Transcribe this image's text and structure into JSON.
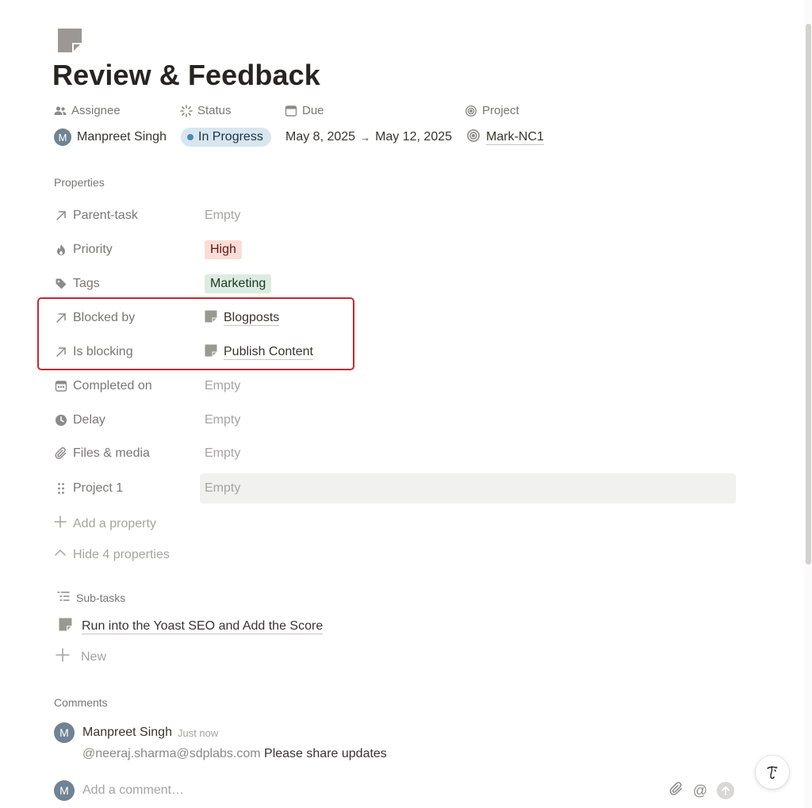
{
  "page": {
    "icon": "page-doc-icon",
    "title": "Review & Feedback"
  },
  "top_properties": {
    "assignee": {
      "label": "Assignee",
      "avatar_initial": "M",
      "value": "Manpreet Singh"
    },
    "status": {
      "label": "Status",
      "value": "In Progress",
      "color": "#d8e6f0",
      "dot_color": "#4a88b7"
    },
    "due": {
      "label": "Due",
      "start": "May 8, 2025",
      "arrow": "→",
      "end": "May 12, 2025"
    },
    "project": {
      "label": "Project",
      "value": "Mark-NC1"
    }
  },
  "properties": {
    "section_label": "Properties",
    "rows": [
      {
        "name": "Parent-task",
        "icon": "arrow-up-right-icon",
        "value": "Empty",
        "empty": true
      },
      {
        "name": "Priority",
        "icon": "fire-icon",
        "value": "High",
        "tag_color": "#fbdcd6"
      },
      {
        "name": "Tags",
        "icon": "tag-icon",
        "value": "Marketing",
        "tag_color": "#dcecdf"
      },
      {
        "name": "Blocked by",
        "icon": "arrow-up-right-icon",
        "value": "Blogposts"
      },
      {
        "name": "Is blocking",
        "icon": "arrow-up-right-icon",
        "value": "Publish Content"
      },
      {
        "name": "Completed on",
        "icon": "calendar-icon",
        "value": "Empty",
        "empty": true
      },
      {
        "name": "Delay",
        "icon": "clock-icon",
        "value": "Empty",
        "empty": true
      },
      {
        "name": "Files & media",
        "icon": "paperclip-icon",
        "value": "Empty",
        "empty": true
      },
      {
        "name": "Project 1",
        "icon": "drag-handle-icon",
        "value": "Empty",
        "empty": true
      }
    ],
    "add_property": "Add a property",
    "hide_properties": "Hide 4 properties",
    "highlight_color": "#c8282f"
  },
  "subtasks": {
    "label": "Sub-tasks",
    "items": [
      "Run into the Yoast SEO and Add the Score"
    ],
    "new_label": "New"
  },
  "comments": {
    "label": "Comments",
    "items": [
      {
        "avatar_initial": "M",
        "author": "Manpreet Singh",
        "time": "Just now",
        "mention": "@neeraj.sharma@sdplabs.com",
        "text": "Please share updates"
      }
    ],
    "input_avatar_initial": "M",
    "input_placeholder": "Add a comment…"
  }
}
